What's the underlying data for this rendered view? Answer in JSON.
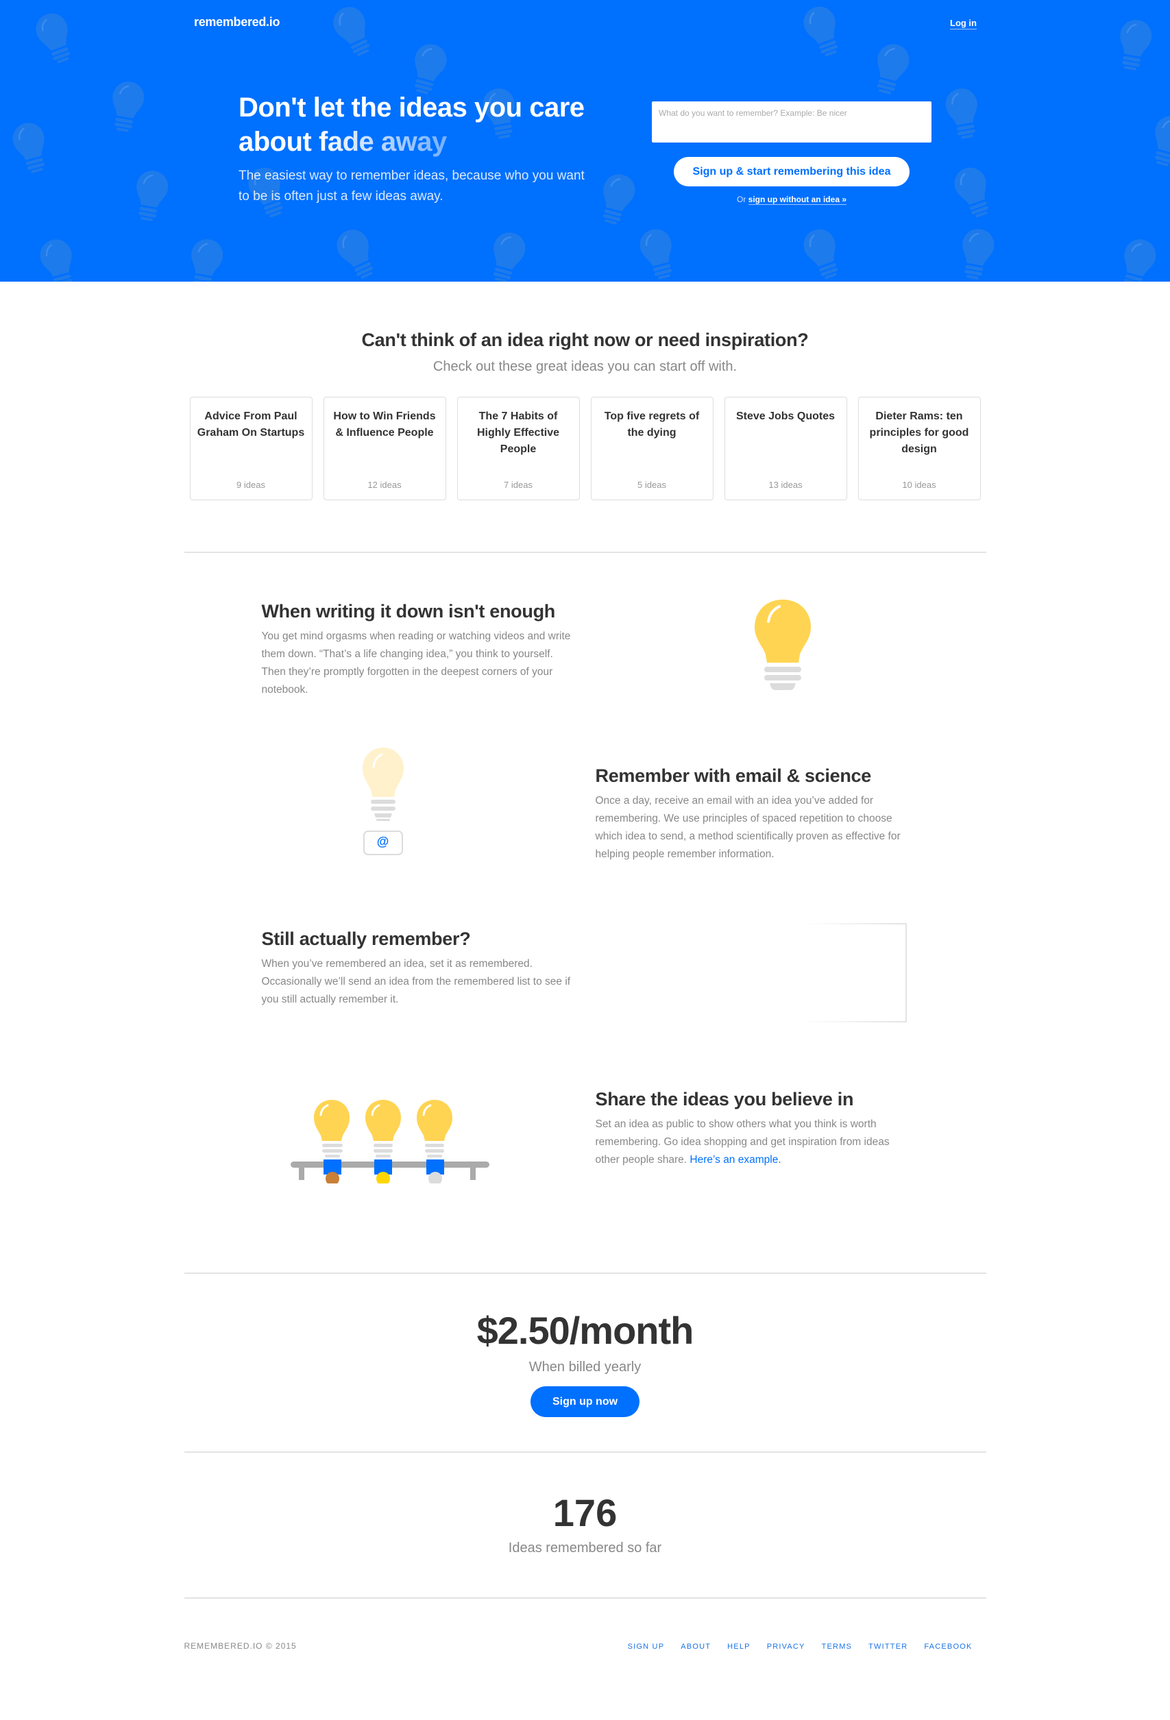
{
  "header": {
    "brand": "remembered.io",
    "login_label": "Log in"
  },
  "hero": {
    "title_part1": "Don't let the ideas you care abo",
    "title_part1b": "ut ",
    "title_fade": "fade away",
    "subtitle": "The easiest way to remember ideas, because who you want to be is often just a few ideas away.",
    "input_placeholder": "What do you want to remember? Example: Be nicer",
    "input_value": "",
    "cta_label": "Sign up & start remembering this idea",
    "alt_prefix": "Or ",
    "alt_link": "sign up without an idea »"
  },
  "inspiration": {
    "title": "Can't think of an idea right now or need inspiration?",
    "subtitle": "Check out these great ideas you can start off with.",
    "cards": [
      {
        "title": "Advice From Paul Graham On Startups",
        "count": "9 ideas"
      },
      {
        "title": "How to Win Friends & Influence People",
        "count": "12 ideas"
      },
      {
        "title": "The 7 Habits of Highly Effective People",
        "count": "7 ideas"
      },
      {
        "title": "Top five regrets of the dying",
        "count": "5 ideas"
      },
      {
        "title": "Steve Jobs Quotes",
        "count": "13 ideas"
      },
      {
        "title": "Dieter Rams: ten principles for good design",
        "count": "10 ideas"
      }
    ]
  },
  "features": [
    {
      "title": "When writing it down isn't enough",
      "body": "You get mind orgasms when reading or watching videos and write them down. “That’s a life changing idea,” you think to yourself. Then they’re promptly forgotten in the deepest corners of your notebook."
    },
    {
      "title": "Remember with email & science",
      "body": "Once a day, receive an email with an idea you’ve added for remembering. We use principles of spaced repetition to choose which idea to send, a method scientifically proven as effective for helping people remember information.",
      "email_icon": "@"
    },
    {
      "title": "Still actually remember?",
      "body": "When you’ve remembered an idea, set it as remembered. Occasionally we’ll send an idea from the remembered list to see if you still actually remember it."
    },
    {
      "title": "Share the ideas you believe in",
      "body": "Set an idea as public to show others what you think is worth remembering. Go idea shopping and get inspiration from ideas other people share. ",
      "link": "Here’s an example."
    }
  ],
  "pricing": {
    "price": "$2.50/month",
    "note": "When billed yearly",
    "button_label": "Sign up now"
  },
  "stats": {
    "count": "176",
    "label": "Ideas remembered so far"
  },
  "footer": {
    "copyright": "REMEMBERED.IO © 2015",
    "links": [
      "SIGN UP",
      "ABOUT",
      "HELP",
      "PRIVACY",
      "TERMS",
      "TWITTER",
      "FACEBOOK"
    ]
  },
  "colors": {
    "brand_blue": "#0070ff",
    "bulb_yellow": "#ffd452",
    "bulb_pale": "#fff1cc",
    "text_dark": "#333333",
    "text_muted": "#888888"
  }
}
